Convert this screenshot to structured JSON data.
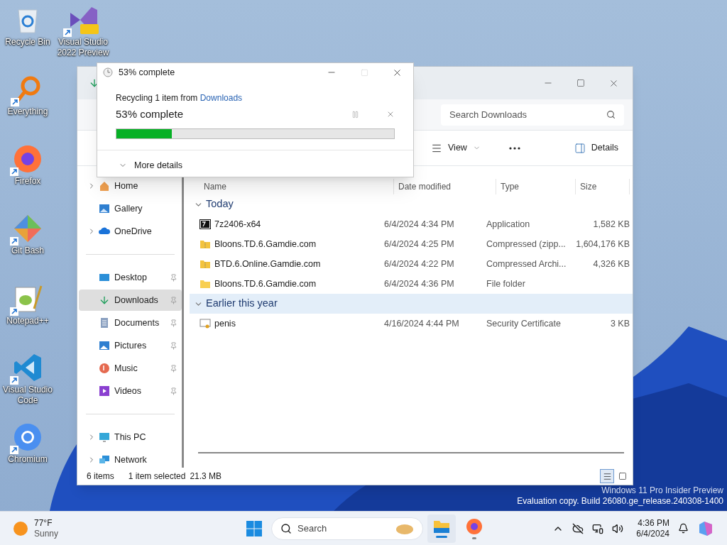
{
  "desktop_icons": [
    {
      "label": "Recycle Bin",
      "kind": "recycle",
      "shortcut": false
    },
    {
      "label": "Visual Studio 2022 Preview",
      "kind": "vs",
      "shortcut": true
    },
    {
      "label": "Everything",
      "kind": "everything",
      "shortcut": true
    },
    {
      "label": "Firefox",
      "kind": "firefox",
      "shortcut": true
    },
    {
      "label": "Git Bash",
      "kind": "git",
      "shortcut": true
    },
    {
      "label": "Notepad++",
      "kind": "notepad",
      "shortcut": true
    },
    {
      "label": "Visual Studio Code",
      "kind": "vscode",
      "shortcut": true
    },
    {
      "label": "Chromium",
      "kind": "chromium",
      "shortcut": true
    }
  ],
  "explorer": {
    "search": {
      "placeholder": "Search Downloads"
    },
    "commands": [
      {
        "label": "View",
        "kind": "view"
      },
      {
        "label": "Details",
        "kind": "details"
      }
    ],
    "nav": [
      [
        {
          "label": "Home",
          "kind": "home",
          "expandable": true,
          "pinned": false,
          "selected": false
        },
        {
          "label": "Gallery",
          "kind": "gallery",
          "expandable": false,
          "pinned": false,
          "selected": false
        },
        {
          "label": "OneDrive",
          "kind": "cloud",
          "expandable": true,
          "pinned": false,
          "selected": false
        }
      ],
      [
        {
          "label": "Desktop",
          "kind": "desktop",
          "expandable": false,
          "pinned": true,
          "selected": false
        },
        {
          "label": "Downloads",
          "kind": "download",
          "expandable": false,
          "pinned": true,
          "selected": true
        },
        {
          "label": "Documents",
          "kind": "document",
          "expandable": false,
          "pinned": true,
          "selected": false
        },
        {
          "label": "Pictures",
          "kind": "pictures",
          "expandable": false,
          "pinned": true,
          "selected": false
        },
        {
          "label": "Music",
          "kind": "music",
          "expandable": false,
          "pinned": true,
          "selected": false
        },
        {
          "label": "Videos",
          "kind": "videos",
          "expandable": false,
          "pinned": true,
          "selected": false
        }
      ],
      [
        {
          "label": "This PC",
          "kind": "pc",
          "expandable": true,
          "pinned": false,
          "selected": false
        },
        {
          "label": "Network",
          "kind": "network",
          "expandable": true,
          "pinned": false,
          "selected": false
        }
      ]
    ],
    "columns": [
      "Name",
      "Date modified",
      "Type",
      "Size"
    ],
    "groups": [
      {
        "title": "Today",
        "expanded": true,
        "highlighted": false,
        "rows": [
          {
            "name": "7z2406-x64",
            "kind": "app",
            "date": "6/4/2024 4:34 PM",
            "type": "Application",
            "size": "1,582 KB"
          },
          {
            "name": "Bloons.TD.6.Gamdie.com",
            "kind": "zip",
            "date": "6/4/2024 4:25 PM",
            "type": "Compressed (zipp...",
            "size": "1,604,176 KB"
          },
          {
            "name": "BTD.6.Online.Gamdie.com",
            "kind": "zip",
            "date": "6/4/2024 4:22 PM",
            "type": "Compressed Archi...",
            "size": "4,326 KB"
          },
          {
            "name": "Bloons.TD.6.Gamdie.com",
            "kind": "folder",
            "date": "6/4/2024 4:36 PM",
            "type": "File folder",
            "size": ""
          }
        ]
      },
      {
        "title": "Earlier this year",
        "expanded": true,
        "highlighted": true,
        "rows": [
          {
            "name": "penis",
            "kind": "cert",
            "date": "4/16/2024 4:44 PM",
            "type": "Security Certificate",
            "size": "3 KB"
          }
        ]
      }
    ],
    "status": {
      "count": "6 items",
      "selection": "1 item selected",
      "selection_size": "21.3 MB"
    },
    "view_modes": [
      {
        "kind": "details",
        "selected": true
      },
      {
        "kind": "tiles",
        "selected": false
      }
    ]
  },
  "progress_dialog": {
    "title": "53% complete",
    "line": "Recycling 1 item from ",
    "link": "Downloads",
    "heading": "53% complete",
    "level": 0.2,
    "more": "More details"
  },
  "watermark": [
    "Windows 11 Pro Insider Preview",
    "Evaluation copy. Build 26080.ge_release.240308-1400"
  ],
  "taskbar": {
    "weather": {
      "temp": "77°F",
      "condition": "Sunny"
    },
    "search": {
      "placeholder": "Search"
    },
    "apps": [
      {
        "kind": "explorer",
        "active": true
      },
      {
        "kind": "firefox",
        "active": false
      }
    ],
    "time": "4:36 PM",
    "date": "6/4/2024"
  }
}
